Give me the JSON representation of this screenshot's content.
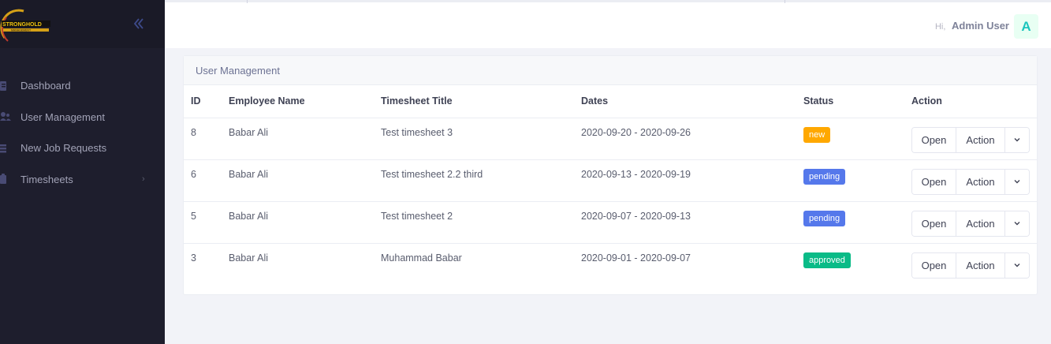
{
  "sidebar": {
    "logo": {
      "text": "STRONGHOLD",
      "subtext": "MANAGEMENT"
    },
    "items": [
      {
        "label": "Dashboard",
        "icon": "dashboard-icon"
      },
      {
        "label": "User Management",
        "icon": "users-icon"
      },
      {
        "label": "New Job Requests",
        "icon": "list-icon"
      },
      {
        "label": "Timesheets",
        "icon": "timesheet-icon",
        "has_submenu": true,
        "arrow": "›"
      }
    ]
  },
  "header": {
    "greeting": "Hi,",
    "user_name": "Admin User",
    "avatar_letter": "A"
  },
  "card": {
    "title": "User Management",
    "columns": [
      "ID",
      "Employee Name",
      "Timesheet Title",
      "Dates",
      "Status",
      "Action"
    ],
    "rows": [
      {
        "id": "8",
        "name": "Babar Ali",
        "title": "Test timesheet 3",
        "dates": "2020-09-20 - 2020-09-26",
        "status": "new",
        "status_color": "#ffa800"
      },
      {
        "id": "6",
        "name": "Babar Ali",
        "title": "Test timesheet 2.2 third",
        "dates": "2020-09-13 - 2020-09-19",
        "status": "pending",
        "status_color": "#5578eb"
      },
      {
        "id": "5",
        "name": "Babar Ali",
        "title": "Test timesheet 2",
        "dates": "2020-09-07 - 2020-09-13",
        "status": "pending",
        "status_color": "#5578eb"
      },
      {
        "id": "3",
        "name": "Babar Ali",
        "title": "Muhammad Babar",
        "dates": "2020-09-01 - 2020-09-07",
        "status": "approved",
        "status_color": "#0abb87"
      }
    ],
    "open_label": "Open",
    "action_label": "Action"
  },
  "colors": {
    "sidebar_bg": "#1e1e2d",
    "brand_bg": "#1a1a27",
    "page_bg": "#f2f3f8",
    "avatar_bg": "#e8fff3",
    "avatar_fg": "#1bc5bd"
  }
}
